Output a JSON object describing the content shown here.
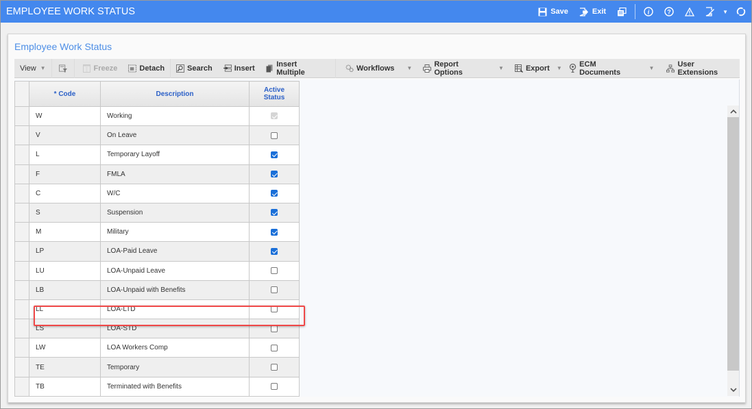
{
  "window": {
    "title": "EMPLOYEE WORK STATUS",
    "actions": {
      "save": "Save",
      "exit": "Exit"
    },
    "icons": [
      "save-icon",
      "exit-icon",
      "windows-icon",
      "info-icon",
      "help-icon",
      "warning-icon",
      "edit-icon",
      "refresh-icon"
    ]
  },
  "panel": {
    "title": "Employee Work Status"
  },
  "toolbar": {
    "view": "View",
    "freeze": "Freeze",
    "detach": "Detach",
    "search": "Search",
    "insert": "Insert",
    "insert_multiple": "Insert Multiple",
    "workflows": "Workflows",
    "report_options": "Report Options",
    "export": "Export",
    "ecm_documents": "ECM Documents",
    "user_extensions": "User Extensions"
  },
  "grid": {
    "columns": {
      "code": "* Code",
      "description": "Description",
      "active_line1": "Active",
      "active_line2": "Status"
    },
    "rows": [
      {
        "code": "W",
        "description": "Working",
        "active": "disabled-checked"
      },
      {
        "code": "V",
        "description": "On Leave",
        "active": "unchecked"
      },
      {
        "code": "L",
        "description": "Temporary Layoff",
        "active": "checked"
      },
      {
        "code": "F",
        "description": "FMLA",
        "active": "checked"
      },
      {
        "code": "C",
        "description": "W/C",
        "active": "checked"
      },
      {
        "code": "S",
        "description": "Suspension",
        "active": "checked"
      },
      {
        "code": "M",
        "description": "Military",
        "active": "checked"
      },
      {
        "code": "LP",
        "description": "LOA-Paid Leave",
        "active": "checked"
      },
      {
        "code": "LU",
        "description": "LOA-Unpaid Leave",
        "active": "unchecked",
        "highlighted": true
      },
      {
        "code": "LB",
        "description": "LOA-Unpaid with Benefits",
        "active": "unchecked"
      },
      {
        "code": "LL",
        "description": "LOA-LTD",
        "active": "unchecked"
      },
      {
        "code": "LS",
        "description": "LOA-STD",
        "active": "unchecked"
      },
      {
        "code": "LW",
        "description": "LOA Workers Comp",
        "active": "unchecked"
      },
      {
        "code": "TE",
        "description": "Temporary",
        "active": "unchecked"
      },
      {
        "code": "TB",
        "description": "Terminated with Benefits",
        "active": "unchecked"
      }
    ]
  },
  "colors": {
    "titlebar": "#4488ee",
    "panel_title": "#4d8ee6",
    "header_text": "#2a5fc7",
    "checkbox": "#1a6fd8",
    "highlight": "#f04848"
  }
}
